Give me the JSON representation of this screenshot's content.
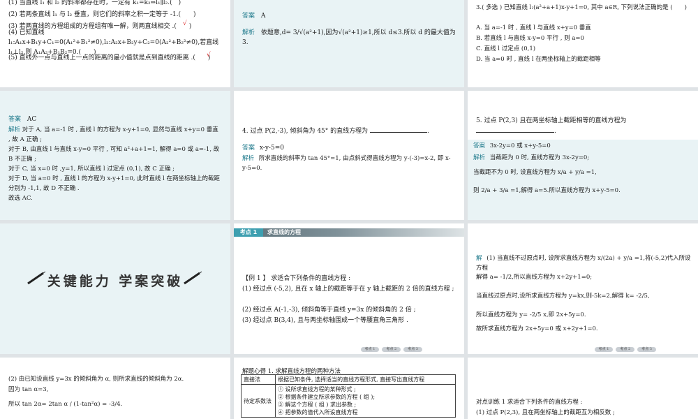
{
  "slide1": {
    "items": [
      "(1) 当直线 l₁ 和 l₂ 的斜率都存在时，一定有 k₁=k₂⇒l₁∥l₂.(　)",
      "(2) 若两条直线 l₁ 与 l₂ 垂直，则它们的斜率之积一定等于 -1.(　　)",
      "(3) 若两直线的方程组成的方程组有唯一解，则两直线相交 .(　　)",
      "(4) 已知直线 l₁:A₁x+B₁y+C₁=0(A₁²+B₁²≠0),l₂:A₂x+B₂y+C₂=0(A₂²+B₂²≠0),若直线 l₁⊥l₂,则 A₁A₂+B₁B₂=0.(　　)",
      "(5) 直线外一点与直线上一点的距离的最小值就是点到直线的距离 .(　　)"
    ],
    "marks": [
      "√"
    ]
  },
  "slide2": {
    "answer_label": "答案",
    "answer": "A",
    "analysis_label": "解析",
    "analysis": "依题意,d= 3/√(a²+1),因为√(a²+1)≥1,所以 d≤3.所以 d 的最大值为 3."
  },
  "slide3": {
    "question": "3.( 多选 ) 已知直线 l:(a²+a+1)x-y+1=0, 其中 a∈R, 下列说法正确的是 (　　)",
    "options": [
      "A. 当 a=-1 时 , 直线 l 与直线 x+y=0 垂直",
      "B. 若直线 l 与直线 x-y=0 平行 , 则 a=0",
      "C. 直线 l 过定点 (0,1)",
      "D. 当 a=0 时 , 直线 l 在两坐标轴上的截距相等"
    ]
  },
  "slide4": {
    "answer_label": "答案",
    "answer": "AC",
    "analysis_label": "解析",
    "lines": [
      "对于 A, 当 a=-1 时 , 直线 l 的方程为 x-y+1=0, 显然与直线 x+y=0 垂直 , 故 A 正确 ;",
      "对于 B, 由直线 l 与直线 x-y=0 平行 , 可知 a²+a+1=1, 解得 a=0 或 a=-1, 故 B 不正确 ;",
      "对于 C, 当 x=0 时 ,y=1, 所以直线 l 过定点 (0,1), 故 C 正确 ;",
      "对于 D, 当 a=0 时 , 直线 l 的方程为 x-y+1=0, 此时直线 l 在两坐标轴上的截距分别为 -1,1, 故 D 不正确 .",
      "故选 AC."
    ]
  },
  "slide5": {
    "question": "4. 过点 P(2,-3), 倾斜角为 45° 的直线方程为",
    "answer_label": "答案",
    "answer": "x-y-5=0",
    "analysis_label": "解析",
    "analysis": "所求直线的斜率为 tan 45°=1, 由点斜式得直线方程为 y-(-3)=x-2, 即 x-y-5=0."
  },
  "slide6": {
    "question": "5. 过点 P(2,3) 且在两坐标轴上截距相等的直线方程为",
    "answer_label": "答案",
    "answer": "3x-2y=0 或 x+y-5=0",
    "analysis_label": "解析",
    "lines": [
      "当截距为 0 时, 直线方程为 3x-2y=0;",
      "当截距不为 0 时, 设直线方程为 x/a + y/a =1,",
      "则 2/a + 3/a =1,解得 a=5.所以直线方程为 x+y-5=0."
    ]
  },
  "slide7": {
    "banner": "关键能力 学案突破"
  },
  "slide8": {
    "tag": "考点 1",
    "tag_title": "求直线的方程",
    "example": "【例 1 】 求适合下列条件的直线方程 :",
    "items": [
      "(1) 经过点 (-5,2), 且在 x 轴上的截距等于在 y 轴上截距的 2 倍的直线方程 ;",
      "(2) 经过点 A(-1,-3), 倾斜角等于直线 y=3x 的倾斜角的 2 倍 ;",
      "(3) 经过点 B(3,4), 且与两坐标轴围成一个等腰直角三角形 ."
    ],
    "nav": [
      "考点 1",
      "考点 2",
      "考点 3"
    ]
  },
  "slide9": {
    "label": "解",
    "lines": [
      "(1) 当直线不过原点时, 设所求直线方程为 x/(2a) + y/a =1,将(-5,2)代入所设方程",
      "解得 a= -1/2,所以直线方程为 x+2y+1=0;",
      "当直线过原点时,设所求直线方程为 y=kx,则-5k=2,解得 k= -2/5,",
      "所以直线方程为 y= -2/5 x,即 2x+5y=0.",
      "故所求直线方程为 2x+5y=0 或 x+2y+1=0."
    ],
    "nav": [
      "考点 1",
      "考点 2",
      "考点 3"
    ]
  },
  "slide10": {
    "lines": [
      "(2) 由已知设直线 y=3x 的倾斜角为 α, 则所求直线的倾斜角为 2α.",
      "因为 tan α=3,",
      "所以 tan 2α= 2tan α / (1-tan²α) = -3/4."
    ]
  },
  "slide11": {
    "heading": "解题心得 1. 求解直线方程的两种方法",
    "rows": [
      {
        "name": "直接法",
        "content": [
          "根据已知条件, 选择适当的直线方程形式, 直接写出直线方程"
        ]
      },
      {
        "name": "待定系数法",
        "content": [
          "① 设所求直线方程的某种形式 ;",
          "② 根据条件建立所求参数的方程 ( 组 );",
          "③ 解这个方程 ( 组 ) 求出参数 ;",
          "④ 把参数的值代入所设直线方程"
        ]
      }
    ]
  },
  "slide12": {
    "heading": "对点训练 1 求适合下列条件的直线方程 :",
    "item": "(1) 过点 P(2,3), 且在两坐标轴上的截距互为相反数 ;"
  }
}
